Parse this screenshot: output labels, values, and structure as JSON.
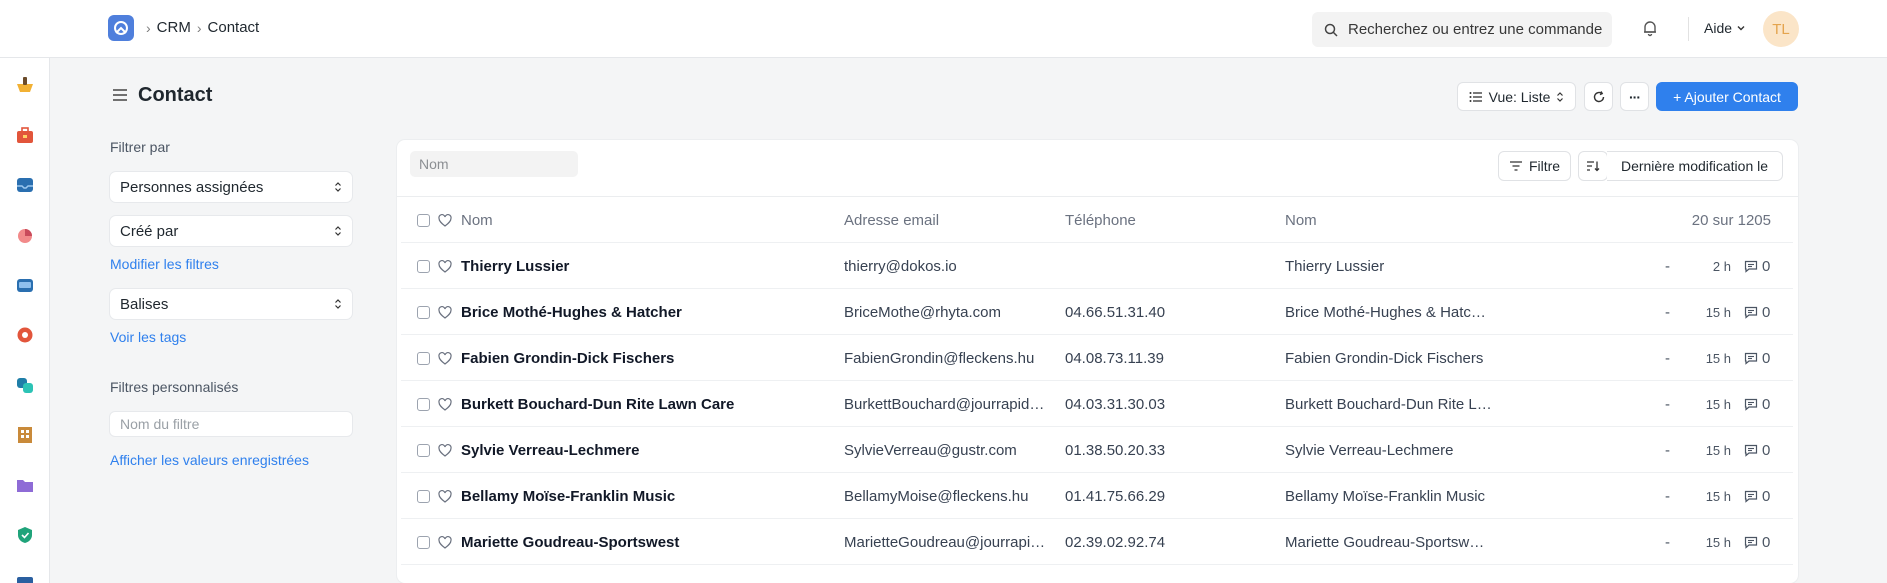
{
  "breadcrumbs": [
    "CRM",
    "Contact"
  ],
  "search": {
    "placeholder": "Recherchez ou entrez une commande"
  },
  "header": {
    "help_label": "Aide",
    "avatar_initials": "TL"
  },
  "page": {
    "title": "Contact",
    "view_label": "Vue: Liste",
    "more_label": "···",
    "add_label": "+ Ajouter Contact"
  },
  "filters": {
    "heading": "Filtrer par",
    "assigned": "Personnes assignées",
    "created_by": "Créé par",
    "edit_filters": "Modifier les filtres",
    "tags": "Balises",
    "see_tags": "Voir les tags",
    "custom_heading": "Filtres personnalisés",
    "filter_name_placeholder": "Nom du filtre",
    "show_saved": "Afficher les valeurs enregistrées"
  },
  "list": {
    "name_placeholder": "Nom",
    "filter_label": "Filtre",
    "sort_label": "Dernière modification le",
    "columns": {
      "name": "Nom",
      "email": "Adresse email",
      "phone": "Téléphone",
      "name2": "Nom",
      "count": "20 sur 1205"
    },
    "rows": [
      {
        "name": "Thierry Lussier",
        "email": "thierry@dokos.io",
        "phone": "",
        "name2": "Thierry Lussier",
        "dash": "-",
        "time": "2 h",
        "comments": "0"
      },
      {
        "name": "Brice Mothé-Hughes & Hatcher",
        "email": "BriceMothe@rhyta.com",
        "phone": "04.66.51.31.40",
        "name2": "Brice Mothé-Hughes & Hatc…",
        "dash": "-",
        "time": "15 h",
        "comments": "0"
      },
      {
        "name": "Fabien Grondin-Dick Fischers",
        "email": "FabienGrondin@fleckens.hu",
        "phone": "04.08.73.11.39",
        "name2": "Fabien Grondin-Dick Fischers",
        "dash": "-",
        "time": "15 h",
        "comments": "0"
      },
      {
        "name": "Burkett Bouchard-Dun Rite Lawn Care",
        "email": "BurkettBouchard@jourrapid…",
        "phone": "04.03.31.30.03",
        "name2": "Burkett Bouchard-Dun Rite L…",
        "dash": "-",
        "time": "15 h",
        "comments": "0"
      },
      {
        "name": "Sylvie Verreau-Lechmere",
        "email": "SylvieVerreau@gustr.com",
        "phone": "01.38.50.20.33",
        "name2": "Sylvie Verreau-Lechmere",
        "dash": "-",
        "time": "15 h",
        "comments": "0"
      },
      {
        "name": "Bellamy Moïse-Franklin Music",
        "email": "BellamyMoise@fleckens.hu",
        "phone": "01.41.75.66.29",
        "name2": "Bellamy Moïse-Franklin Music",
        "dash": "-",
        "time": "15 h",
        "comments": "0"
      },
      {
        "name": "Mariette Goudreau-Sportswest",
        "email": "MarietteGoudreau@jourrapi…",
        "phone": "02.39.02.92.74",
        "name2": "Mariette Goudreau-Sportsw…",
        "dash": "-",
        "time": "15 h",
        "comments": "0"
      }
    ]
  },
  "colors": {
    "primary": "#2f80ed",
    "link": "#2f80ed",
    "avatar_bg": "#fbe5c8",
    "avatar_fg": "#e4a44e"
  }
}
